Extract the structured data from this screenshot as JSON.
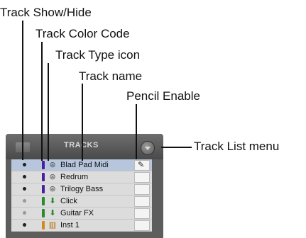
{
  "callouts": {
    "show_hide": "Track Show/Hide",
    "color_code": "Track Color Code",
    "type_icon": "Track Type icon",
    "track_name": "Track name",
    "pencil_enable": "Pencil Enable",
    "list_menu": "Track List menu"
  },
  "panel": {
    "title": "TRACKS",
    "tracks": [
      {
        "name": "Blad Pad Midi",
        "type": "midi",
        "color": "#4a1fa0",
        "shown": true,
        "selected": true,
        "pencil": true
      },
      {
        "name": "Redrum",
        "type": "midi",
        "color": "#4a1fa0",
        "shown": true,
        "selected": false,
        "pencil": false
      },
      {
        "name": "Trilogy Bass",
        "type": "midi",
        "color": "#4a1fa0",
        "shown": true,
        "selected": false,
        "pencil": false
      },
      {
        "name": "Click",
        "type": "aux",
        "color": "#2c8a2c",
        "shown": false,
        "selected": false,
        "pencil": false
      },
      {
        "name": "Guitar FX",
        "type": "aux",
        "color": "#2c8a2c",
        "shown": false,
        "selected": false,
        "pencil": false
      },
      {
        "name": "Inst 1",
        "type": "instrument",
        "color": "#d48a1a",
        "shown": true,
        "selected": false,
        "pencil": false
      }
    ]
  }
}
